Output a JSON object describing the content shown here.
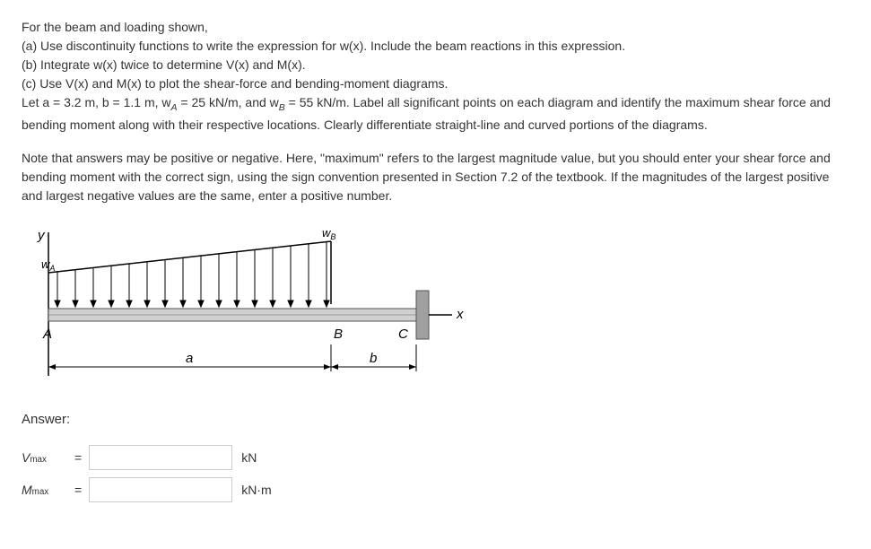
{
  "problem": {
    "intro": "For the beam and loading shown,",
    "part_a": "(a) Use discontinuity functions to write the expression for w(x). Include the beam reactions in this expression.",
    "part_b": "(b) Integrate w(x) twice to determine V(x) and M(x).",
    "part_c": "(c) Use V(x) and M(x) to plot the shear-force and bending-moment diagrams.",
    "params": "Let a = 3.2 m, b = 1.1 m, w",
    "params_sub1": "A",
    "params_mid1": " = 25 kN/m, and w",
    "params_sub2": "B",
    "params_mid2": " = 55 kN/m. Label all significant points on each diagram and identify the maximum shear force and bending moment along with their respective locations. Clearly differentiate straight-line and curved portions of the diagrams.",
    "note": "Note that answers may be positive or negative. Here, \"maximum\" refers to the largest magnitude value, but you should enter your shear force and bending moment with the correct sign, using the sign convention presented in Section 7.2 of the textbook. If the magnitudes of the largest positive and largest negative values are the same, enter a positive number."
  },
  "diagram": {
    "label_y": "y",
    "label_wA": "A",
    "label_wB": "B",
    "label_w_prefix": "w",
    "label_A": "A",
    "label_B": "B",
    "label_C": "C",
    "label_a": "a",
    "label_b": "b",
    "label_x": "x"
  },
  "answer": {
    "heading": "Answer:",
    "vmax_label": "V",
    "vmax_sub": "max",
    "mmax_label": "M",
    "mmax_sub": "max",
    "equals": "=",
    "unit_v": "kN",
    "unit_m": "kN·m",
    "vmax_value": "",
    "mmax_value": ""
  }
}
